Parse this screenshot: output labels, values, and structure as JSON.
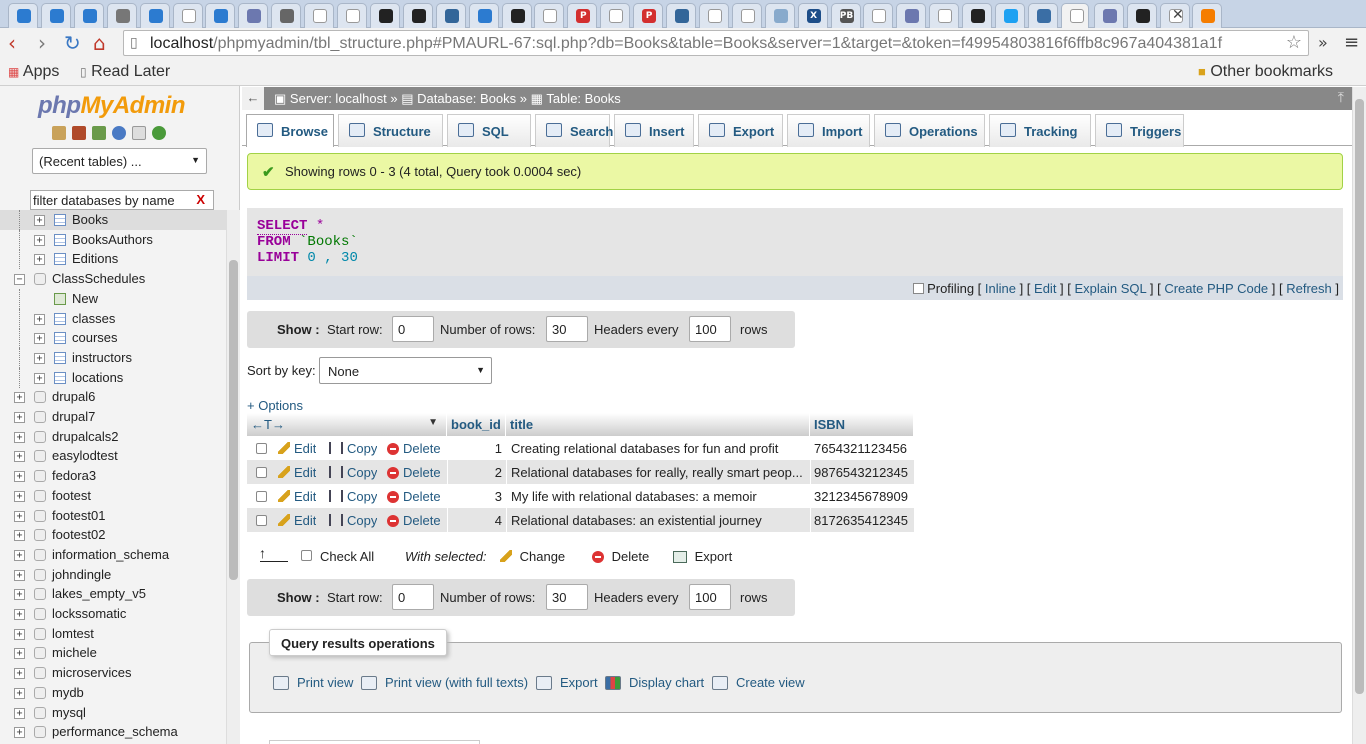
{
  "browser": {
    "url_host": "localhost",
    "url_rest": "/phpmyadmin/tbl_structure.php#PMAURL-67:sql.php?db=Books&table=Books&server=1&target=&token=f49954803816f6ffb8c967a404381a1f",
    "bookmarks": {
      "apps": "Apps",
      "read_later": "Read Later",
      "other": "Other bookmarks"
    },
    "tab_favicons": [
      "drupal",
      "drupal",
      "drupal",
      "image",
      "drupal",
      "page",
      "drupal",
      "php",
      "grid",
      "page",
      "page",
      "github",
      "github",
      "tree",
      "drupal",
      "github",
      "page",
      "P",
      "page",
      "P",
      "tree",
      "page",
      "page",
      "cloud",
      "X",
      "PB",
      "page",
      "php",
      "page",
      "github",
      "twitter",
      "sql",
      "active",
      "php",
      "github",
      "page",
      "blogger"
    ],
    "tab_favicon_colors": {
      "drupal": "#2c7bd0",
      "page": "#ffffff",
      "image": "#777777",
      "php": "#6c78af",
      "grid": "#666666",
      "github": "#222222",
      "tree": "#336699",
      "P": "#d32f2f",
      "cloud": "#88aacc",
      "X": "#1d4e89",
      "PB": "#555555",
      "twitter": "#1da1f2",
      "sql": "#3a6ea5",
      "active": "#ffffff",
      "blogger": "#f57d00"
    }
  },
  "sidebar": {
    "logo_php": "php",
    "logo_ma": "MyAdmin",
    "recent": "(Recent tables) ...",
    "filter_placeholder": "filter databases by name",
    "filter_clear": "X",
    "tree": [
      {
        "label": "Books",
        "level": 2,
        "type": "table",
        "expander": "+",
        "selected": true
      },
      {
        "label": "BooksAuthors",
        "level": 2,
        "type": "table",
        "expander": "+"
      },
      {
        "label": "Editions",
        "level": 2,
        "type": "table",
        "expander": "+"
      },
      {
        "label": "ClassSchedules",
        "level": 1,
        "type": "db",
        "expander": "-"
      },
      {
        "label": "New",
        "level": 2,
        "type": "new",
        "expander": ""
      },
      {
        "label": "classes",
        "level": 2,
        "type": "table",
        "expander": "+"
      },
      {
        "label": "courses",
        "level": 2,
        "type": "table",
        "expander": "+"
      },
      {
        "label": "instructors",
        "level": 2,
        "type": "table",
        "expander": "+"
      },
      {
        "label": "locations",
        "level": 2,
        "type": "table",
        "expander": "+"
      },
      {
        "label": "drupal6",
        "level": 1,
        "type": "db",
        "expander": "+"
      },
      {
        "label": "drupal7",
        "level": 1,
        "type": "db",
        "expander": "+"
      },
      {
        "label": "drupalcals2",
        "level": 1,
        "type": "db",
        "expander": "+"
      },
      {
        "label": "easylodtest",
        "level": 1,
        "type": "db",
        "expander": "+"
      },
      {
        "label": "fedora3",
        "level": 1,
        "type": "db",
        "expander": "+"
      },
      {
        "label": "footest",
        "level": 1,
        "type": "db",
        "expander": "+"
      },
      {
        "label": "footest01",
        "level": 1,
        "type": "db",
        "expander": "+"
      },
      {
        "label": "footest02",
        "level": 1,
        "type": "db",
        "expander": "+"
      },
      {
        "label": "information_schema",
        "level": 1,
        "type": "db",
        "expander": "+"
      },
      {
        "label": "johndingle",
        "level": 1,
        "type": "db",
        "expander": "+"
      },
      {
        "label": "lakes_empty_v5",
        "level": 1,
        "type": "db",
        "expander": "+"
      },
      {
        "label": "lockssomatic",
        "level": 1,
        "type": "db",
        "expander": "+"
      },
      {
        "label": "lomtest",
        "level": 1,
        "type": "db",
        "expander": "+"
      },
      {
        "label": "michele",
        "level": 1,
        "type": "db",
        "expander": "+"
      },
      {
        "label": "microservices",
        "level": 1,
        "type": "db",
        "expander": "+"
      },
      {
        "label": "mydb",
        "level": 1,
        "type": "db",
        "expander": "+"
      },
      {
        "label": "mysql",
        "level": 1,
        "type": "db",
        "expander": "+"
      },
      {
        "label": "performance_schema",
        "level": 1,
        "type": "db",
        "expander": "+"
      }
    ]
  },
  "breadcrumb": {
    "back": "←",
    "server": "Server: localhost",
    "sep": "»",
    "database": "Database: Books",
    "table": "Table: Books"
  },
  "tabs": [
    "Browse",
    "Structure",
    "SQL",
    "Search",
    "Insert",
    "Export",
    "Import",
    "Operations",
    "Tracking",
    "Triggers"
  ],
  "notice": "Showing rows 0 - 3 (4 total, Query took 0.0004 sec)",
  "sql": {
    "select": "SELECT",
    "star": "*",
    "from": "FROM",
    "table": "`Books`",
    "limit": "LIMIT",
    "offset": "0",
    "comma": ",",
    "count": "30",
    "profiling": "Profiling",
    "inline": "Inline",
    "edit": "Edit",
    "explain": "Explain SQL",
    "create_php": "Create PHP Code",
    "refresh": "Refresh"
  },
  "showbar": {
    "show": "Show :",
    "start_row_label": "Start row:",
    "start_row": "0",
    "num_rows_label": "Number of rows:",
    "num_rows": "30",
    "headers_label": "Headers every",
    "headers": "100",
    "rows": "rows"
  },
  "sort": {
    "label": "Sort by key:",
    "value": "None"
  },
  "options_link": "+ Options",
  "grid": {
    "columns": [
      "book_id",
      "title",
      "ISBN"
    ],
    "actions": {
      "edit": "Edit",
      "copy": "Copy",
      "delete": "Delete"
    },
    "rows": [
      {
        "book_id": "1",
        "title": "Creating relational databases for fun and profit",
        "isbn": "7654321123456"
      },
      {
        "book_id": "2",
        "title": "Relational databases for really, really smart peop...",
        "isbn": "9876543212345"
      },
      {
        "book_id": "3",
        "title": "My life with relational databases: a memoir",
        "isbn": "3212345678909"
      },
      {
        "book_id": "4",
        "title": "Relational databases: an existential journey",
        "isbn": "8172635412345"
      }
    ]
  },
  "with_selected": {
    "check_all": "Check All",
    "label": "With selected:",
    "change": "Change",
    "delete": "Delete",
    "export": "Export"
  },
  "qro": {
    "legend": "Query results operations",
    "print_view": "Print view",
    "print_full": "Print view (with full texts)",
    "export": "Export",
    "chart": "Display chart",
    "create_view": "Create view"
  }
}
